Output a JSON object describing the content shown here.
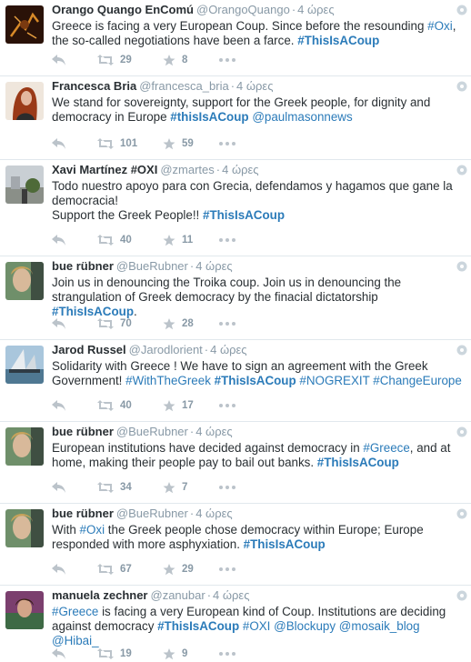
{
  "tweets": [
    {
      "name": "Orango Quango EnComú",
      "handle": "@OrangoQuango",
      "time": "4 ώρες",
      "text_parts": [
        "Greece is facing a very European Coup. Since before the resounding ",
        "#Oxi",
        ", the so-called negotiations have been a farce. ",
        "#ThisIsACoup"
      ],
      "retweets": "29",
      "favorites": "8"
    },
    {
      "name": "Francesca Bria",
      "handle": "@francesca_bria",
      "time": "4 ώρες",
      "text_parts": [
        "We stand for sovereignty, support for the Greek people, for dignity and democracy in Europe ",
        "#thisIsACoup",
        " ",
        "@paulmasonnews"
      ],
      "retweets": "101",
      "favorites": "59"
    },
    {
      "name": "Xavi Martínez #OXI",
      "handle": "@zmartes",
      "time": "4 ώρες",
      "text_parts": [
        "Todo nuestro apoyo para con Grecia, defendamos y hagamos que gane la democracia!",
        "Support the Greek People!! ",
        "#ThisIsACoup"
      ],
      "retweets": "40",
      "favorites": "11"
    },
    {
      "name": "bue rübner",
      "handle": "@BueRubner",
      "time": "4 ώρες",
      "text_parts": [
        "Join us in denouncing the Troika coup. Join us in denouncing the strangulation of Greek democracy by the finacial dictatorship ",
        "#ThisIsACoup",
        "."
      ],
      "retweets": "70",
      "favorites": "28"
    },
    {
      "name": "Jarod Russel",
      "handle": "@Jarodlorient",
      "time": "4 ώρες",
      "text_parts": [
        "Solidarity with Greece ! We have to sign an agreement with the Greek Government! ",
        "#WithTheGreek",
        " ",
        "#ThisIsACoup",
        " ",
        "#NOGREXIT",
        " ",
        "#ChangeEurope"
      ],
      "retweets": "40",
      "favorites": "17"
    },
    {
      "name": "bue rübner",
      "handle": "@BueRubner",
      "time": "4 ώρες",
      "text_parts": [
        "European institutions have decided against democracy in ",
        "#Greece",
        ", and at home, making their people pay to bail out banks. ",
        "#ThisIsACoup"
      ],
      "retweets": "34",
      "favorites": "7"
    },
    {
      "name": "bue rübner",
      "handle": "@BueRubner",
      "time": "4 ώρες",
      "text_parts": [
        "With ",
        "#Oxi",
        " the Greek people chose democracy within Europe; Europe responded with more asphyxiation. ",
        "#ThisIsACoup"
      ],
      "retweets": "67",
      "favorites": "29"
    },
    {
      "name": "manuela zechner",
      "handle": "@zanubar",
      "time": "4 ώρες",
      "text_parts": [
        "#Greece",
        " is facing a very European kind of Coup. Institutions are deciding against democracy ",
        "#ThisIsACoup",
        " ",
        "#OXI",
        " ",
        "@Blockupy",
        " ",
        "@mosaik_blog",
        " ",
        "@Hibai_"
      ],
      "retweets": "19",
      "favorites": "9"
    }
  ],
  "icons": {
    "reply": "reply-icon",
    "retweet": "retweet-icon",
    "favorite": "star-icon",
    "more": "more-icon",
    "options": "gear-icon"
  },
  "colors": {
    "link": "#2b7bb9",
    "muted": "#8899a6",
    "icon": "#bbc3ca",
    "text": "#292f33",
    "divider": "#e1e8ed"
  }
}
